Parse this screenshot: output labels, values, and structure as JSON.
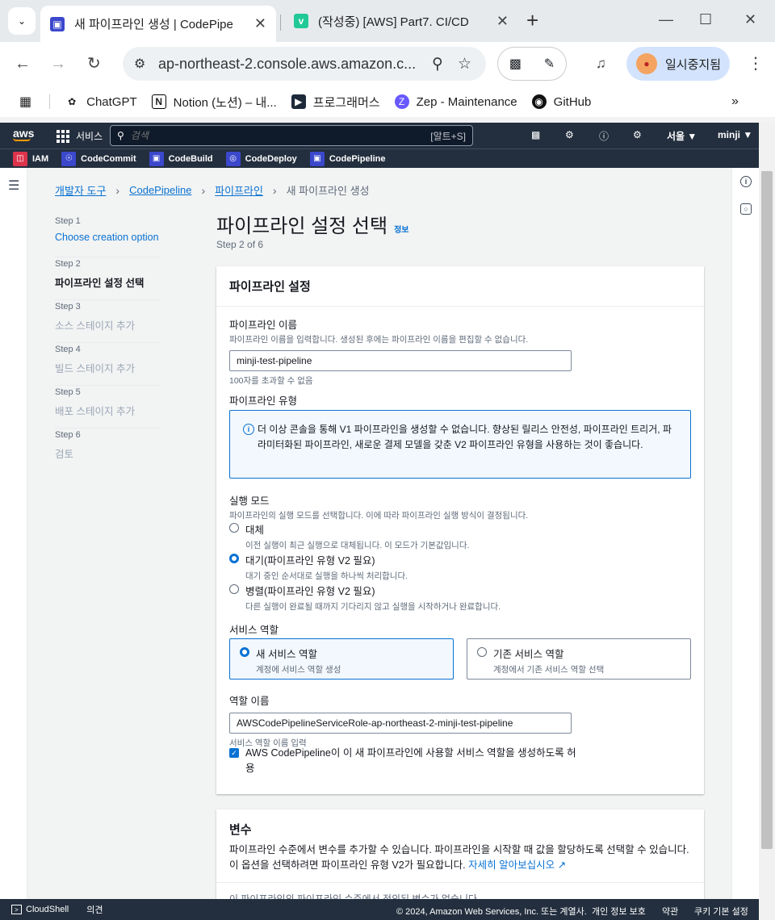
{
  "browser": {
    "tabs": [
      {
        "title": "새 파이프라인 생성 | CodePipe",
        "favicon": "codepipeline-icon",
        "favicon_color": "#3b48cc"
      },
      {
        "title": "(작성중) [AWS] Part7. CI/CD",
        "favicon": "velog-icon",
        "favicon_color": "#20c997"
      }
    ],
    "url": "ap-northeast-2.console.aws.amazon.c...",
    "paused_label": "일시중지됨",
    "bookmarks": [
      {
        "label": "ChatGPT",
        "icon": "chatgpt-icon"
      },
      {
        "label": "Notion (노션) – 내...",
        "icon": "notion-icon"
      },
      {
        "label": "프로그래머스",
        "icon": "programmers-icon"
      },
      {
        "label": "Zep - Maintenance",
        "icon": "zep-icon"
      },
      {
        "label": "GitHub",
        "icon": "github-icon"
      }
    ]
  },
  "aws_nav": {
    "logo": "aws",
    "services_label": "서비스",
    "search_placeholder": "검색",
    "search_shortcut": "[알트+S]",
    "region": "서울 ▼",
    "user": "minji ▼",
    "favorites": [
      {
        "label": "IAM",
        "color": "#dd344c"
      },
      {
        "label": "CodeCommit",
        "color": "#3b48cc"
      },
      {
        "label": "CodeBuild",
        "color": "#3b48cc"
      },
      {
        "label": "CodeDeploy",
        "color": "#3b48cc"
      },
      {
        "label": "CodePipeline",
        "color": "#3b48cc"
      }
    ]
  },
  "breadcrumb": [
    "개발자 도구",
    "CodePipeline",
    "파이프라인",
    "새 파이프라인 생성"
  ],
  "steps": [
    {
      "num": "Step 1",
      "label": "Choose creation option",
      "state": "link"
    },
    {
      "num": "Step 2",
      "label": "파이프라인 설정 선택",
      "state": "active"
    },
    {
      "num": "Step 3",
      "label": "소스 스테이지 추가",
      "state": "disabled"
    },
    {
      "num": "Step 4",
      "label": "빌드 스테이지 추가",
      "state": "disabled"
    },
    {
      "num": "Step 5",
      "label": "배포 스테이지 추가",
      "state": "disabled"
    },
    {
      "num": "Step 6",
      "label": "검토",
      "state": "disabled"
    }
  ],
  "page": {
    "title": "파이프라인 설정 선택",
    "info_link": "정보",
    "subtitle": "Step 2 of 6"
  },
  "settings": {
    "header": "파이프라인 설정",
    "name_label": "파이프라인 이름",
    "name_desc": "파이프라인 이름을 입력합니다. 생성된 후에는 파이프라인 이름을 편집할 수 없습니다.",
    "name_value": "minji-test-pipeline",
    "name_constraint": "100자를 초과할 수 없음",
    "type_label": "파이프라인 유형",
    "type_info": "더 이상 콘솔을 통해 V1 파이프라인을 생성할 수 없습니다. 향상된 릴리스 안전성, 파이프라인 트리거, 파라미터화된 파이프라인, 새로운 결제 모델을 갖춘 V2 파이프라인 유형을 사용하는 것이 좋습니다.",
    "mode_label": "실행 모드",
    "mode_desc": "파이프라인의 실행 모드를 선택합니다. 이에 따라 파이프라인 실행 방식이 결정됩니다.",
    "modes": [
      {
        "title": "대체",
        "desc": "이전 실행이 최근 실행으로 대체됩니다. 이 모드가 기본값입니다.",
        "selected": false
      },
      {
        "title": "대기(파이프라인 유형 V2 필요)",
        "desc": "대기 중인 순서대로 실행을 하나씩 처리합니다.",
        "selected": true
      },
      {
        "title": "병렬(파이프라인 유형 V2 필요)",
        "desc": "다른 실행이 완료될 때까지 기다리지 않고 실행을 시작하거나 완료합니다.",
        "selected": false
      }
    ],
    "role_label": "서비스 역할",
    "roles": [
      {
        "title": "새 서비스 역할",
        "desc": "계정에 서비스 역할 생성",
        "selected": true
      },
      {
        "title": "기존 서비스 역할",
        "desc": "계정에서 기존 서비스 역할 선택",
        "selected": false
      }
    ],
    "role_name_label": "역할 이름",
    "role_name_value": "AWSCodePipelineServiceRole-ap-northeast-2-minji-test-pipeline",
    "role_name_hint": "서비스 역할 이름 입력",
    "allow_checkbox": "AWS CodePipeline이 이 새 파이프라인에 사용할 서비스 역할을 생성하도록 허용"
  },
  "variables": {
    "header": "변수",
    "desc": "파이프라인 수준에서 변수를 추가할 수 있습니다. 파이프라인을 시작할 때 값을 할당하도록 선택할 수 있습니다. 이 옵션을 선택하려면 파이프라인 유형 V2가 필요합니다.",
    "learn_more": "자세히 알아보십시오",
    "empty_text": "이 파이프라인의 파이프라인 수준에서 정의된 변수가 없습니다."
  },
  "footer": {
    "cloudshell": "CloudShell",
    "feedback": "의견",
    "copyright": "© 2024, Amazon Web Services, Inc. 또는 계열사.",
    "privacy": "개인 정보 보호",
    "terms": "약관",
    "cookies": "쿠키 기본 설정"
  }
}
